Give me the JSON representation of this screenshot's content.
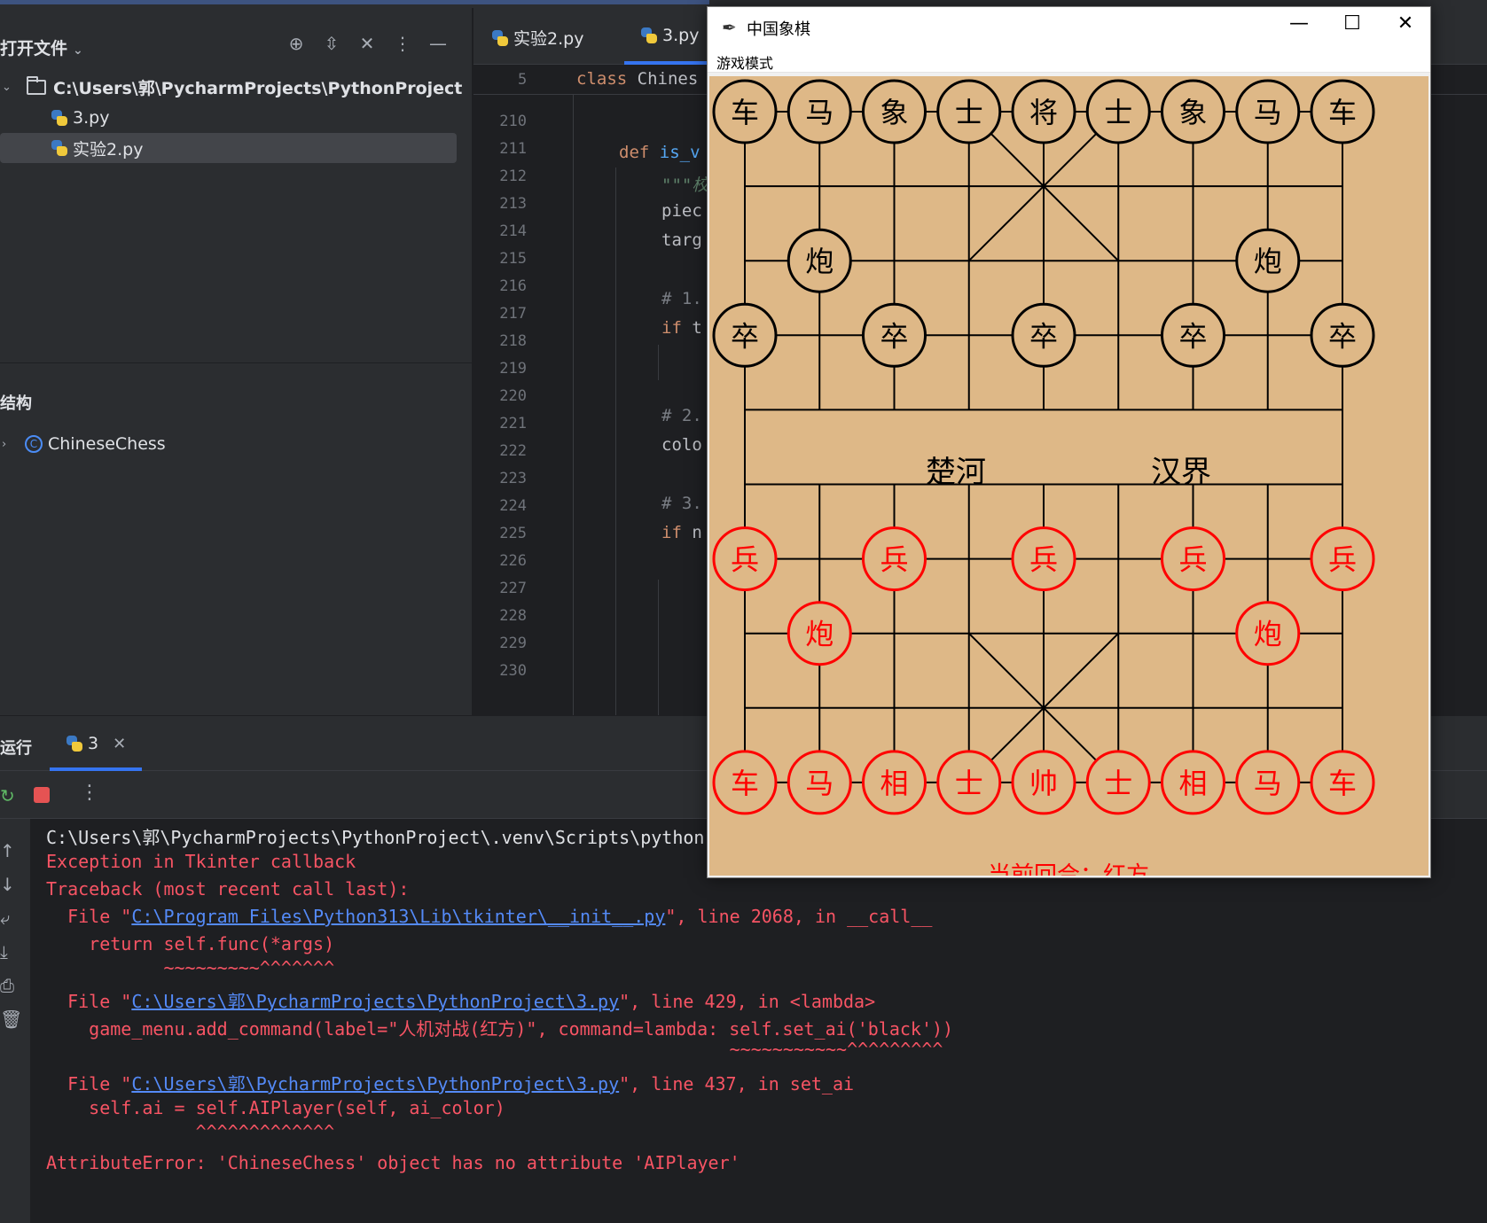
{
  "project_panel": {
    "title": "打开文件",
    "root_path": "C:\\Users\\郭\\PycharmProjects\\PythonProject",
    "files": [
      {
        "name": "3.py"
      },
      {
        "name": "实验2.py"
      }
    ],
    "structure_title": "结构",
    "structure_item": "ChineseChess"
  },
  "editor": {
    "tabs": [
      {
        "label": "实验2.py"
      },
      {
        "label": "3.py"
      }
    ],
    "sticky_line_no": "5",
    "sticky_code": "class Chines",
    "line_numbers": [
      "210",
      "211",
      "212",
      "213",
      "214",
      "215",
      "216",
      "217",
      "218",
      "219",
      "220",
      "221",
      "222",
      "223",
      "224",
      "225",
      "226",
      "227",
      "228",
      "229",
      "230"
    ],
    "code": {
      "l211_kw": "def ",
      "l211_fn": "is_v",
      "l212": "\"\"\"校",
      "l213": "piec",
      "l214": "targ",
      "l216": "# 1.",
      "l217_kw": "if ",
      "l217_rest": "t",
      "l220": "# 2.",
      "l221": "colo",
      "l223": "# 3.",
      "l224_kw": "if ",
      "l224_rest": "n"
    }
  },
  "run_panel": {
    "title": "运行",
    "tab_label": "3",
    "console": [
      {
        "text": "C:\\Users\\郭\\PycharmProjects\\PythonProject\\.venv\\Scripts\\python"
      },
      {
        "text": "Exception in Tkinter callback"
      },
      {
        "text": "Traceback (most recent call last):"
      },
      {
        "pre": "  File \"",
        "link": "C:\\Program Files\\Python313\\Lib\\tkinter\\__init__.py",
        "post": "\", line 2068, in __call__"
      },
      {
        "text": "    return self.func(*args)"
      },
      {
        "text": "           ~~~~~~~~~^^^^^^^"
      },
      {
        "pre": "  File \"",
        "link": "C:\\Users\\郭\\PycharmProjects\\PythonProject\\3.py",
        "post": "\", line 429, in <lambda>"
      },
      {
        "text": "    game_menu.add_command(label=\"人机对战(红方)\", command=lambda: self.set_ai('black'))"
      },
      {
        "text": "                                                                ~~~~~~~~~~~^^^^^^^^^"
      },
      {
        "pre": "  File \"",
        "link": "C:\\Users\\郭\\PycharmProjects\\PythonProject\\3.py",
        "post": "\", line 437, in set_ai"
      },
      {
        "text": "    self.ai = self.AIPlayer(self, ai_color)"
      },
      {
        "text": "              ^^^^^^^^^^^^^"
      },
      {
        "text": "AttributeError: 'ChineseChess' object has no attribute 'AIPlayer'"
      }
    ]
  },
  "tk_window": {
    "title": "中国象棋",
    "menu": "游戏模式",
    "river_left": "楚河",
    "river_right": "汉界",
    "status_text": "当前回合：红方",
    "black_pieces": [
      {
        "c": 0,
        "r": 0,
        "t": "车"
      },
      {
        "c": 1,
        "r": 0,
        "t": "马"
      },
      {
        "c": 2,
        "r": 0,
        "t": "象"
      },
      {
        "c": 3,
        "r": 0,
        "t": "士"
      },
      {
        "c": 4,
        "r": 0,
        "t": "将"
      },
      {
        "c": 5,
        "r": 0,
        "t": "士"
      },
      {
        "c": 6,
        "r": 0,
        "t": "象"
      },
      {
        "c": 7,
        "r": 0,
        "t": "马"
      },
      {
        "c": 8,
        "r": 0,
        "t": "车"
      },
      {
        "c": 1,
        "r": 2,
        "t": "炮"
      },
      {
        "c": 7,
        "r": 2,
        "t": "炮"
      },
      {
        "c": 0,
        "r": 3,
        "t": "卒"
      },
      {
        "c": 2,
        "r": 3,
        "t": "卒"
      },
      {
        "c": 4,
        "r": 3,
        "t": "卒"
      },
      {
        "c": 6,
        "r": 3,
        "t": "卒"
      },
      {
        "c": 8,
        "r": 3,
        "t": "卒"
      }
    ],
    "red_pieces": [
      {
        "c": 0,
        "r": 6,
        "t": "兵"
      },
      {
        "c": 2,
        "r": 6,
        "t": "兵"
      },
      {
        "c": 4,
        "r": 6,
        "t": "兵"
      },
      {
        "c": 6,
        "r": 6,
        "t": "兵"
      },
      {
        "c": 8,
        "r": 6,
        "t": "兵"
      },
      {
        "c": 1,
        "r": 7,
        "t": "炮"
      },
      {
        "c": 7,
        "r": 7,
        "t": "炮"
      },
      {
        "c": 0,
        "r": 9,
        "t": "车"
      },
      {
        "c": 1,
        "r": 9,
        "t": "马"
      },
      {
        "c": 2,
        "r": 9,
        "t": "相"
      },
      {
        "c": 3,
        "r": 9,
        "t": "士"
      },
      {
        "c": 4,
        "r": 9,
        "t": "帅"
      },
      {
        "c": 5,
        "r": 9,
        "t": "士"
      },
      {
        "c": 6,
        "r": 9,
        "t": "相"
      },
      {
        "c": 7,
        "r": 9,
        "t": "马"
      },
      {
        "c": 8,
        "r": 9,
        "t": "车"
      }
    ],
    "colors": {
      "board": "#deb887",
      "black": "#000000",
      "red": "#ff0000"
    }
  }
}
